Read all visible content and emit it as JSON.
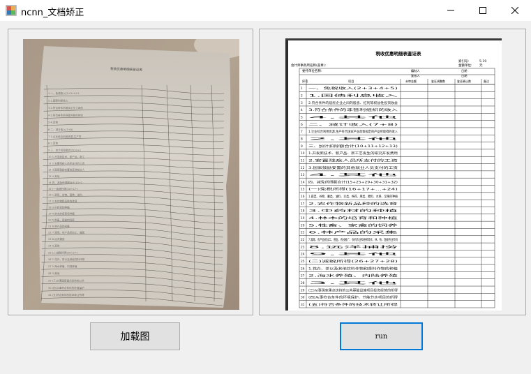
{
  "window": {
    "title": "ncnn_文档矫正",
    "controls": {
      "minimize": "—",
      "maximize": "☐",
      "close": "✕"
    }
  },
  "document": {
    "title": "税收优惠明细表鉴证表",
    "header_left": "会计师事务所名称(盖章):",
    "client_label": "委托单位名称:",
    "ref_label": "索引号:",
    "ref_value": "5-19",
    "unit_label": "金额单位:",
    "unit_value": "元",
    "col_headers": [
      "序号",
      "项目",
      "未审金额",
      "鉴证调整数",
      "鉴证确认数",
      "备注"
    ],
    "meta_labels": [
      "编制人",
      "复核人",
      "日期",
      "日期"
    ],
    "rows": [
      [
        "1",
        "一、免税收入(2+3+4+5)"
      ],
      [
        "2",
        "1.国债利息收入"
      ],
      [
        "3",
        "2.符合条件的居民企业之间的股息、红利等权益性投资收益"
      ],
      [
        "4",
        "3.符合条件的非营利组织的收入"
      ],
      [
        "5",
        "4.其他"
      ],
      [
        "6",
        "二、减计收入(7+8)"
      ],
      [
        "7",
        "1.企业综合利用资源,生产符合国家产业政策规定的产品所取得的收入"
      ],
      [
        "8",
        "2.其他"
      ],
      [
        "9",
        "三、加计扣除额合计(10+11+12+13)"
      ],
      [
        "10",
        "1.开发新技术、新产品、新工艺发生的研究开发费用"
      ],
      [
        "11",
        "2.安置残疾人员所支付的工资"
      ],
      [
        "12",
        "3.国家鼓励安置的其他就业人员支付的工资"
      ],
      [
        "13",
        "4.其他"
      ],
      [
        "14",
        "四、减免所得额合计(15+25+29+30+31+32)"
      ],
      [
        "15",
        "(一)免税所得(16+17+…+24)"
      ],
      [
        "16",
        "1.蔬菜、谷物、薯类、油料、豆类、棉花、麻类、糖料、水果、坚果的种植"
      ],
      [
        "17",
        "2.农作物新品种的选育"
      ],
      [
        "18",
        "3.中药材的种植"
      ],
      [
        "19",
        "4.林木的培育和种植"
      ],
      [
        "20",
        "5.牲畜、家禽的饲养"
      ],
      [
        "21",
        "6.林产品的采集"
      ],
      [
        "22",
        "7.灌溉、农产品初加工、兽医、农技推广、农机作业和维修等农、林、牧、渔服务业项目"
      ],
      [
        "23",
        "8.远洋捕捞"
      ],
      [
        "24",
        "9.其他"
      ],
      [
        "25",
        "(二)减税所得(26+27+28)"
      ],
      [
        "26",
        "1.花卉、茶以及其他饮料作物和香料作物的种植"
      ],
      [
        "27",
        "2.海水养殖、内陆养殖"
      ],
      [
        "28",
        "3.其他"
      ],
      [
        "29",
        "(三)从事国家重点扶持的公共基础设施项目投资经营的所得"
      ],
      [
        "30",
        "(四)从事符合条件的环境保护、节能节水项目的所得"
      ],
      [
        "31",
        "(五)符合条件的技术转让所得"
      ]
    ]
  },
  "buttons": {
    "load": "加载图",
    "run": "run"
  },
  "colors": {
    "focus_border": "#0078d7",
    "button_bg": "#e1e1e1"
  }
}
